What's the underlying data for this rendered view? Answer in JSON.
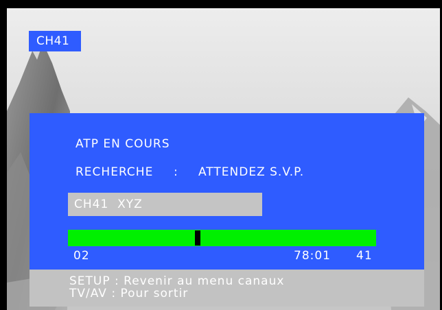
{
  "channel_badge": "CH41",
  "atp": {
    "status": "ATP EN COURS",
    "search_label": "RECHERCHE",
    "search_separator": ":",
    "search_value": "ATTENDEZ S.V.P.",
    "channel_field": "CH41  XYZ",
    "progress": 0.42,
    "start_channel": "02",
    "frequency": "78:01",
    "end_channel": "41"
  },
  "help": {
    "setup": "SETUP : Revenir au menu canaux",
    "tvav": "TV/AV : Pour sortir"
  },
  "colors": {
    "panel_blue": "#2f5cff",
    "progress_green": "#00f000",
    "field_grey": "#c4c4c4",
    "help_grey": "#c2c2c2"
  }
}
